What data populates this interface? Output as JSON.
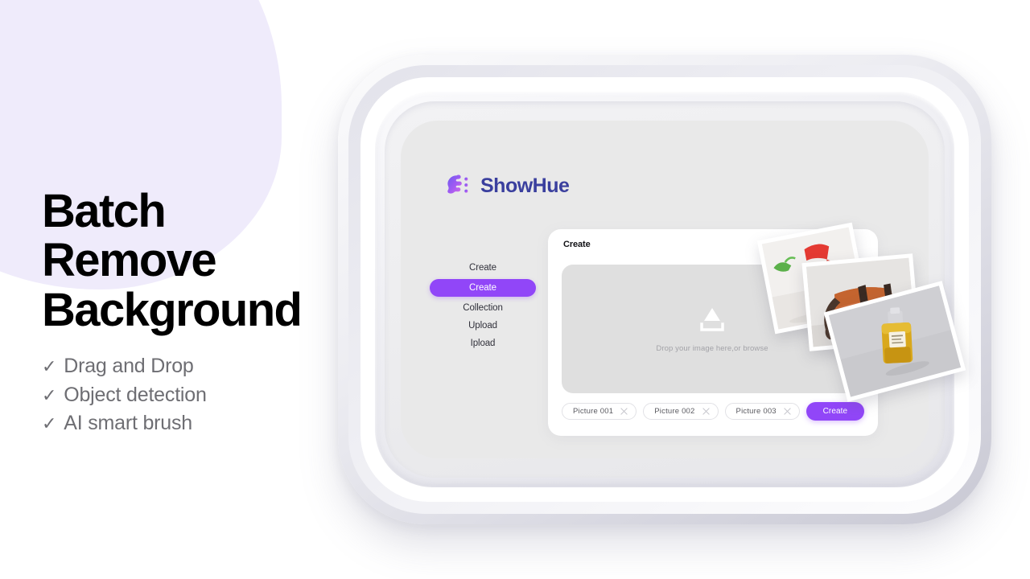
{
  "promo": {
    "title_lines": [
      "Batch",
      "Remove",
      "Background"
    ],
    "features": [
      {
        "check": "✓",
        "label": "Drag and Drop"
      },
      {
        "check": "✓",
        "label": "Object detection"
      },
      {
        "check": "✓",
        "label": "AI smart brush"
      }
    ]
  },
  "app": {
    "brand": {
      "name": "ShowHue"
    },
    "sidebar": {
      "groups": [
        {
          "heading": "Create",
          "items": [
            {
              "label": "Create",
              "active": true
            },
            {
              "label": "Collection",
              "active": false
            }
          ]
        },
        {
          "heading": "Upload",
          "items": [
            {
              "label": "Ipload",
              "active": false
            }
          ]
        }
      ]
    },
    "content": {
      "title": "Create",
      "dropzone": {
        "label": "Drop your image here,or browse"
      },
      "chips": [
        {
          "label": "Picture  001",
          "close": "×"
        },
        {
          "label": "Picture  002",
          "close": "×"
        },
        {
          "label": "Picture  003",
          "close": "×"
        }
      ],
      "create_button": "Create"
    },
    "photos": [
      {
        "alt": "red high heel shoes on white floor"
      },
      {
        "alt": "orange leather messenger bag"
      },
      {
        "alt": "yellow perfume bottle on grey backdrop"
      }
    ]
  },
  "colors": {
    "accent_purple": "#9146F8",
    "brand_navy": "#3A3F9E",
    "blob_lavender": "#EFEBFB",
    "screen_grey": "#E9E9E9",
    "dropzone_grey": "#DFDFDF",
    "muted_text": "#6E6E73"
  }
}
